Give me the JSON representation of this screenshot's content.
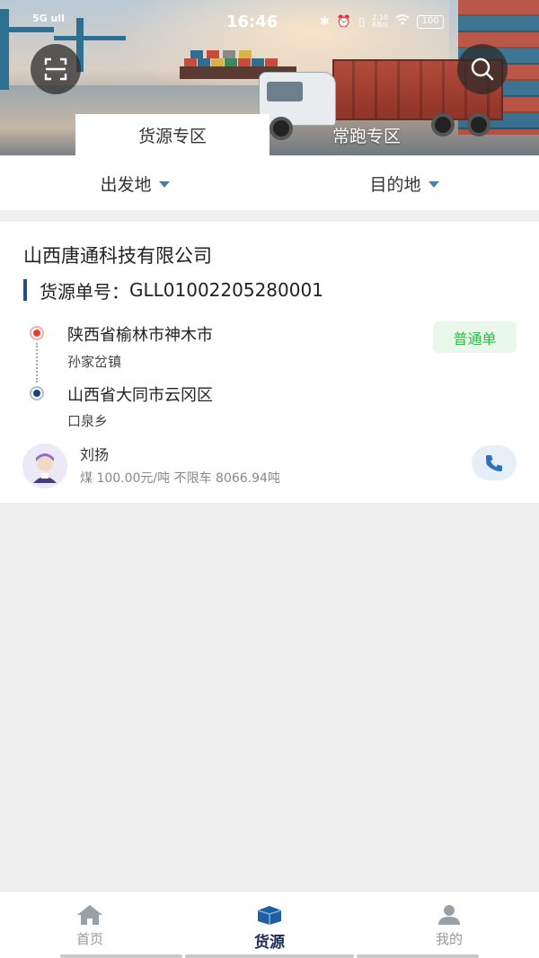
{
  "status_bar": {
    "carrier": "5G ull",
    "time": "16:46",
    "net_speed_value": "2.10",
    "net_speed_unit": "KB/s",
    "battery": "100"
  },
  "header": {
    "scan_icon": "scan-icon",
    "search_icon": "search-icon",
    "tabs": [
      {
        "label": "货源专区",
        "active": true
      },
      {
        "label": "常跑专区",
        "active": false
      }
    ]
  },
  "filters": {
    "origin_label": "出发地",
    "destination_label": "目的地"
  },
  "card": {
    "company": "山西唐通科技有限公司",
    "order_label": "货源单号：",
    "order_number": "GLL01002205280001",
    "from": {
      "main": "陕西省榆林市神木市",
      "sub": "孙家岔镇"
    },
    "to": {
      "main": "山西省大同市云冈区",
      "sub": "口泉乡"
    },
    "badge": "普通单",
    "contact_name": "刘扬",
    "cargo_info": "煤 100.00元/吨 不限车 8066.94吨",
    "colors": {
      "badge_text": "#2fb64a",
      "from_dot": "#e1422f",
      "to_dot": "#18427a",
      "accent": "#1f4f85"
    }
  },
  "bottom_nav": {
    "items": [
      {
        "label": "首页",
        "icon": "home-icon",
        "active": false
      },
      {
        "label": "货源",
        "icon": "cargo-box-icon",
        "active": true
      },
      {
        "label": "我的",
        "icon": "user-icon",
        "active": false
      }
    ]
  }
}
